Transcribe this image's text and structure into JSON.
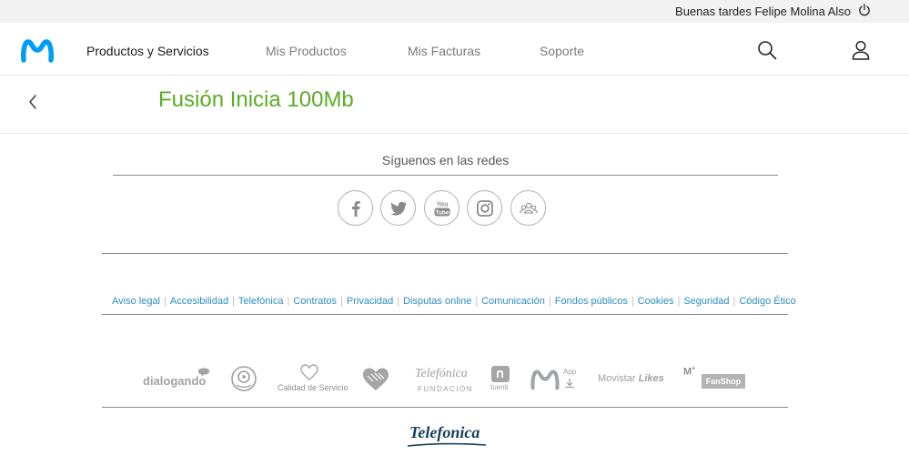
{
  "header": {
    "greeting": "Buenas tardes Felipe Molina Also",
    "power_icon": "power-icon"
  },
  "nav": {
    "logo": "movistar-logo",
    "items": [
      {
        "label": "Productos y Servicios",
        "active": true
      },
      {
        "label": "Mis Productos",
        "active": false
      },
      {
        "label": "Mis Facturas",
        "active": false
      },
      {
        "label": "Soporte",
        "active": false
      }
    ],
    "icons": [
      "search-icon",
      "user-icon"
    ]
  },
  "page": {
    "title": "Fusión Inicia 100Mb",
    "back_icon": "chevron-left-icon"
  },
  "social": {
    "heading": "Síguenos en las redes",
    "networks": [
      "facebook",
      "twitter",
      "youtube",
      "instagram",
      "community"
    ]
  },
  "footer": {
    "links": [
      "Aviso legal",
      "Accesibilidad",
      "Telefónica",
      "Contratos",
      "Privacidad",
      "Disputas online",
      "Comunicación",
      "Fondos públicos",
      "Cookies",
      "Seguridad",
      "Código Ético"
    ],
    "partners": {
      "dialogando": "dialogando",
      "calidad": "Calidad de Servicio",
      "fundacion_name": "Telefónica",
      "fundacion_sub": "FUNDACIÓN",
      "tuenti": "tuenti",
      "app": "App",
      "likes_prefix": "Movistar",
      "likes_suffix": "Likes",
      "fanshop": "FanShop"
    },
    "brand": "Telefonica"
  },
  "colors": {
    "accent_green": "#5bac26",
    "link_blue": "#2a8fbd",
    "movistar_blue": "#019df4"
  }
}
